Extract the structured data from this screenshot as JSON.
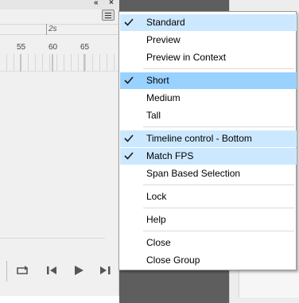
{
  "panel": {
    "collapse_glyph": "«",
    "close_glyph": "×",
    "ruler_label": "2s",
    "frame_numbers": [
      "55",
      "60",
      "65"
    ]
  },
  "menu": {
    "items": [
      {
        "label": "Standard",
        "checked": true
      },
      {
        "label": "Preview",
        "checked": false
      },
      {
        "label": "Preview in Context",
        "checked": false
      },
      {
        "label": "Short",
        "checked": true,
        "active": true
      },
      {
        "label": "Medium",
        "checked": false
      },
      {
        "label": "Tall",
        "checked": false
      },
      {
        "label": "Timeline control - Bottom",
        "checked": true
      },
      {
        "label": "Match FPS",
        "checked": true
      },
      {
        "label": "Span Based Selection",
        "checked": false
      },
      {
        "label": "Lock",
        "checked": false
      },
      {
        "label": "Help",
        "checked": false
      },
      {
        "label": "Close",
        "checked": false
      },
      {
        "label": "Close Group",
        "checked": false
      }
    ]
  },
  "colors": {
    "check_highlight": "#cce8ff",
    "active_highlight": "#99d1ff",
    "check_mark": "#1a1a1a"
  },
  "icons": [
    "collapse-icon",
    "close-icon",
    "panel-menu-icon",
    "loop-icon",
    "step-back-icon",
    "play-icon",
    "step-forward-icon",
    "checkmark-icon"
  ]
}
